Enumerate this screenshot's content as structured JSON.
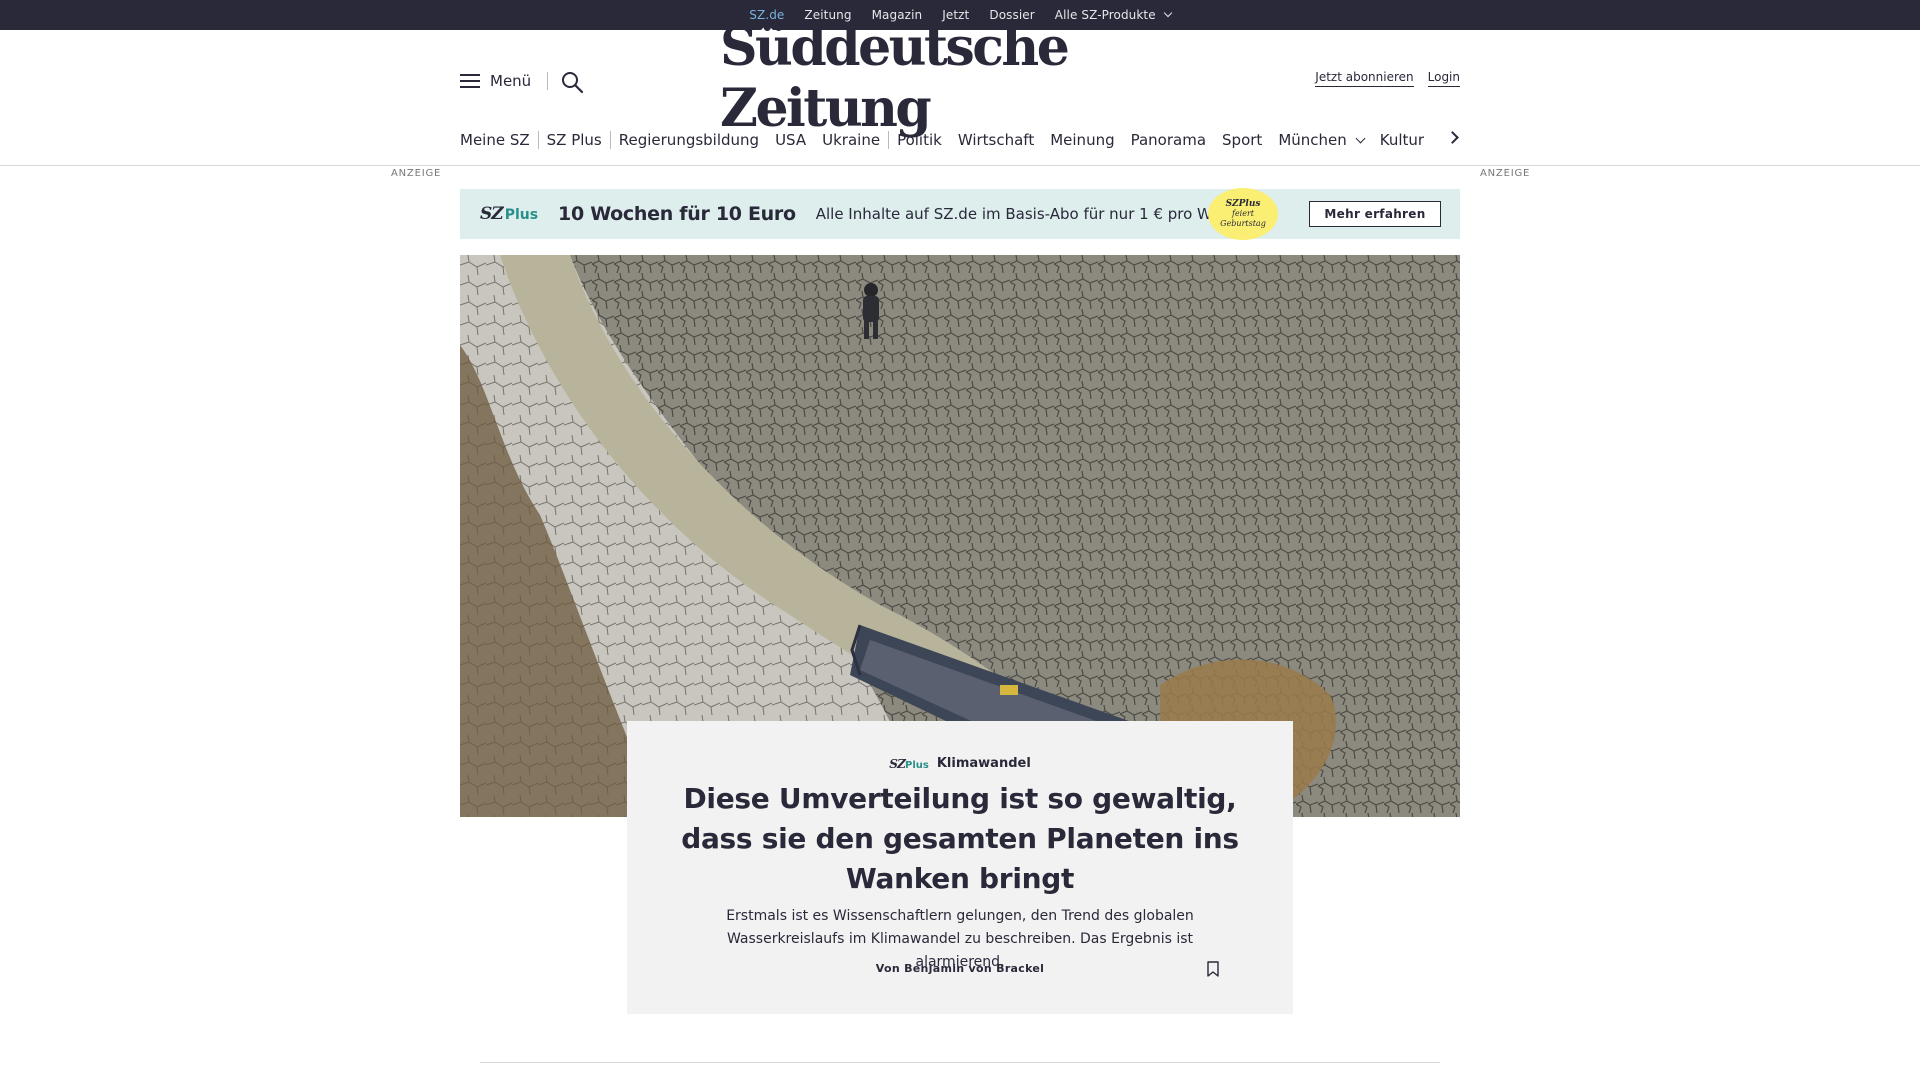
{
  "topbar": {
    "items": [
      "SZ.de",
      "Zeitung",
      "Magazin",
      "Jetzt",
      "Dossier",
      "Alle SZ-Produkte"
    ]
  },
  "header": {
    "menu_label": "Menü",
    "logo": "Süddeutsche Zeitung",
    "subscribe": "Jetzt abonnieren",
    "login": "Login"
  },
  "nav": {
    "items": [
      "Meine SZ",
      "SZ Plus",
      "Regierungsbildung",
      "USA",
      "Ukraine",
      "Politik",
      "Wirtschaft",
      "Meinung",
      "Panorama",
      "Sport",
      "München",
      "Kultur"
    ]
  },
  "ad": {
    "label_left": "ANZEIGE",
    "label_right": "ANZEIGE"
  },
  "promo": {
    "brand_sz": "SZ",
    "brand_plus": "Plus",
    "headline": "10 Wochen für 10 Euro",
    "text": "Alle Inhalte auf SZ.de im Basis-Abo für nur 1 € pro Woche.",
    "badge_line1": "SZPlus",
    "badge_line2": "feiert",
    "badge_line3": "Geburtstag",
    "cta": "Mehr erfahren",
    "bg_color": "#ddeeed",
    "badge_color": "#faef73"
  },
  "article": {
    "kicker_sz": "SZ",
    "kicker_plus": "Plus",
    "kicker_topic": "Klimawandel",
    "title": "Diese Umverteilung ist so gewaltig, dass sie den gesamten Planeten ins Wanken bringt",
    "teaser": "Erstmals ist es Wissenschaftlern gelungen, den Trend des globalen Wasserkreislaufs im Klimawandel zu beschreiben. Das Ergebnis ist alarmierend.",
    "author": "Von Benjamin von Brackel",
    "bookmark_icon": "bookmark-icon"
  },
  "colors": {
    "topbar": "#29293a",
    "active_link": "#7ab3d9",
    "plus_accent": "#2a8f8a"
  }
}
